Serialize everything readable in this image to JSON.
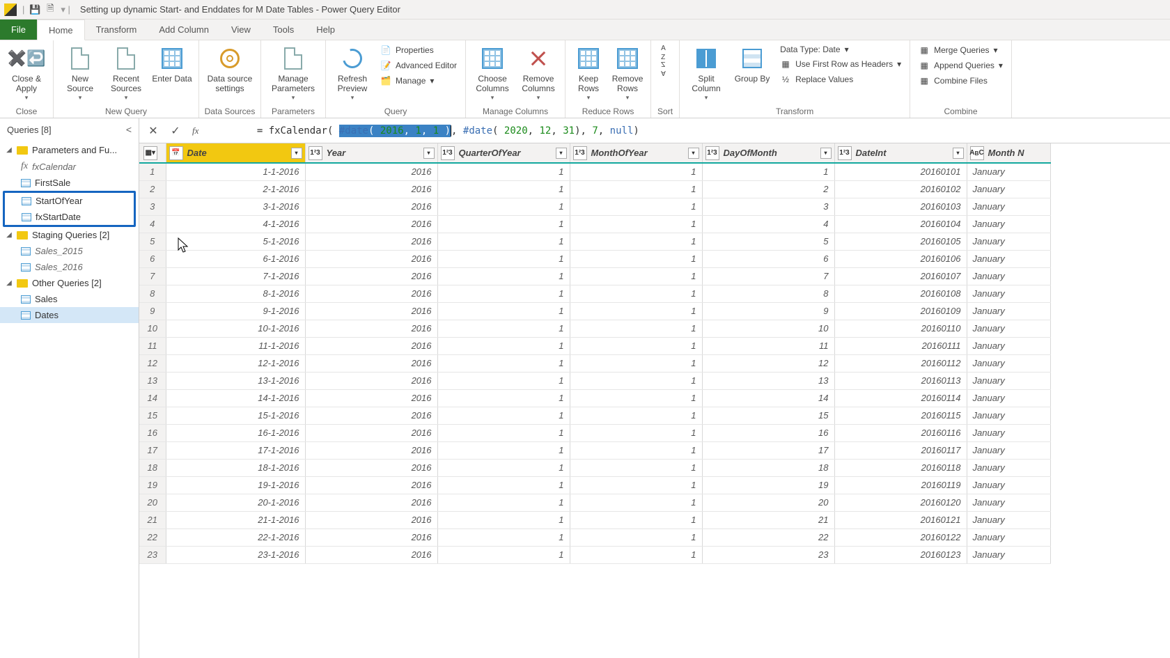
{
  "titlebar": {
    "app_title": "Setting up dynamic Start- and Enddates for M Date Tables - Power Query Editor"
  },
  "ribbon_tabs": {
    "file": "File",
    "home": "Home",
    "transform": "Transform",
    "add_column": "Add Column",
    "view": "View",
    "tools": "Tools",
    "help": "Help"
  },
  "ribbon": {
    "close_apply": "Close & Apply",
    "close_group": "Close",
    "new_source": "New Source",
    "recent_sources": "Recent Sources",
    "enter_data": "Enter Data",
    "new_query_group": "New Query",
    "data_source_settings": "Data source settings",
    "data_sources_group": "Data Sources",
    "manage_parameters": "Manage Parameters",
    "parameters_group": "Parameters",
    "refresh_preview": "Refresh Preview",
    "properties": "Properties",
    "advanced_editor": "Advanced Editor",
    "manage": "Manage",
    "query_group": "Query",
    "choose_columns": "Choose Columns",
    "remove_columns": "Remove Columns",
    "manage_columns_group": "Manage Columns",
    "keep_rows": "Keep Rows",
    "remove_rows": "Remove Rows",
    "reduce_rows_group": "Reduce Rows",
    "sort_group": "Sort",
    "split_column": "Split Column",
    "group_by": "Group By",
    "data_type": "Data Type: Date",
    "first_row_headers": "Use First Row as Headers",
    "replace_values": "Replace Values",
    "transform_group": "Transform",
    "merge_queries": "Merge Queries",
    "append_queries": "Append Queries",
    "combine_files": "Combine Files",
    "combine_group": "Combine"
  },
  "queries_pane": {
    "header": "Queries [8]",
    "group_params": "Parameters and Fu...",
    "fxCalendar": "fxCalendar",
    "FirstSale": "FirstSale",
    "StartOfYear": "StartOfYear",
    "fxStartDate": "fxStartDate",
    "group_staging": "Staging Queries [2]",
    "Sales_2015": "Sales_2015",
    "Sales_2016": "Sales_2016",
    "group_other": "Other Queries [2]",
    "Sales": "Sales",
    "Dates": "Dates"
  },
  "formula_bar": {
    "prefix": "= ",
    "fn": "fxCalendar",
    "open": "( ",
    "sel_part": "#date( 2016, 1, 1 )",
    "mid": ", ",
    "date2_kw": "#date",
    "date2_open": "( ",
    "y2": "2020",
    "c1": ", ",
    "m2": "12",
    "c2": ", ",
    "d2": "31",
    "date2_close": ")",
    "c3": ", ",
    "arg7": "7",
    "c4": ", ",
    "argnull": "null",
    "close": ")"
  },
  "columns": [
    {
      "name": "Date",
      "type": "date",
      "type_icon": "📅"
    },
    {
      "name": "Year",
      "type": "int",
      "type_icon": "1²3"
    },
    {
      "name": "QuarterOfYear",
      "type": "int",
      "type_icon": "1²3"
    },
    {
      "name": "MonthOfYear",
      "type": "int",
      "type_icon": "1²3"
    },
    {
      "name": "DayOfMonth",
      "type": "int",
      "type_icon": "1²3"
    },
    {
      "name": "DateInt",
      "type": "int",
      "type_icon": "1²3"
    },
    {
      "name": "Month N",
      "type": "text",
      "type_icon": "ABC"
    }
  ],
  "rows": [
    {
      "n": "1",
      "Date": "1-1-2016",
      "Year": "2016",
      "QuarterOfYear": "1",
      "MonthOfYear": "1",
      "DayOfMonth": "1",
      "DateInt": "20160101",
      "MonthN": "January"
    },
    {
      "n": "2",
      "Date": "2-1-2016",
      "Year": "2016",
      "QuarterOfYear": "1",
      "MonthOfYear": "1",
      "DayOfMonth": "2",
      "DateInt": "20160102",
      "MonthN": "January"
    },
    {
      "n": "3",
      "Date": "3-1-2016",
      "Year": "2016",
      "QuarterOfYear": "1",
      "MonthOfYear": "1",
      "DayOfMonth": "3",
      "DateInt": "20160103",
      "MonthN": "January"
    },
    {
      "n": "4",
      "Date": "4-1-2016",
      "Year": "2016",
      "QuarterOfYear": "1",
      "MonthOfYear": "1",
      "DayOfMonth": "4",
      "DateInt": "20160104",
      "MonthN": "January"
    },
    {
      "n": "5",
      "Date": "5-1-2016",
      "Year": "2016",
      "QuarterOfYear": "1",
      "MonthOfYear": "1",
      "DayOfMonth": "5",
      "DateInt": "20160105",
      "MonthN": "January"
    },
    {
      "n": "6",
      "Date": "6-1-2016",
      "Year": "2016",
      "QuarterOfYear": "1",
      "MonthOfYear": "1",
      "DayOfMonth": "6",
      "DateInt": "20160106",
      "MonthN": "January"
    },
    {
      "n": "7",
      "Date": "7-1-2016",
      "Year": "2016",
      "QuarterOfYear": "1",
      "MonthOfYear": "1",
      "DayOfMonth": "7",
      "DateInt": "20160107",
      "MonthN": "January"
    },
    {
      "n": "8",
      "Date": "8-1-2016",
      "Year": "2016",
      "QuarterOfYear": "1",
      "MonthOfYear": "1",
      "DayOfMonth": "8",
      "DateInt": "20160108",
      "MonthN": "January"
    },
    {
      "n": "9",
      "Date": "9-1-2016",
      "Year": "2016",
      "QuarterOfYear": "1",
      "MonthOfYear": "1",
      "DayOfMonth": "9",
      "DateInt": "20160109",
      "MonthN": "January"
    },
    {
      "n": "10",
      "Date": "10-1-2016",
      "Year": "2016",
      "QuarterOfYear": "1",
      "MonthOfYear": "1",
      "DayOfMonth": "10",
      "DateInt": "20160110",
      "MonthN": "January"
    },
    {
      "n": "11",
      "Date": "11-1-2016",
      "Year": "2016",
      "QuarterOfYear": "1",
      "MonthOfYear": "1",
      "DayOfMonth": "11",
      "DateInt": "20160111",
      "MonthN": "January"
    },
    {
      "n": "12",
      "Date": "12-1-2016",
      "Year": "2016",
      "QuarterOfYear": "1",
      "MonthOfYear": "1",
      "DayOfMonth": "12",
      "DateInt": "20160112",
      "MonthN": "January"
    },
    {
      "n": "13",
      "Date": "13-1-2016",
      "Year": "2016",
      "QuarterOfYear": "1",
      "MonthOfYear": "1",
      "DayOfMonth": "13",
      "DateInt": "20160113",
      "MonthN": "January"
    },
    {
      "n": "14",
      "Date": "14-1-2016",
      "Year": "2016",
      "QuarterOfYear": "1",
      "MonthOfYear": "1",
      "DayOfMonth": "14",
      "DateInt": "20160114",
      "MonthN": "January"
    },
    {
      "n": "15",
      "Date": "15-1-2016",
      "Year": "2016",
      "QuarterOfYear": "1",
      "MonthOfYear": "1",
      "DayOfMonth": "15",
      "DateInt": "20160115",
      "MonthN": "January"
    },
    {
      "n": "16",
      "Date": "16-1-2016",
      "Year": "2016",
      "QuarterOfYear": "1",
      "MonthOfYear": "1",
      "DayOfMonth": "16",
      "DateInt": "20160116",
      "MonthN": "January"
    },
    {
      "n": "17",
      "Date": "17-1-2016",
      "Year": "2016",
      "QuarterOfYear": "1",
      "MonthOfYear": "1",
      "DayOfMonth": "17",
      "DateInt": "20160117",
      "MonthN": "January"
    },
    {
      "n": "18",
      "Date": "18-1-2016",
      "Year": "2016",
      "QuarterOfYear": "1",
      "MonthOfYear": "1",
      "DayOfMonth": "18",
      "DateInt": "20160118",
      "MonthN": "January"
    },
    {
      "n": "19",
      "Date": "19-1-2016",
      "Year": "2016",
      "QuarterOfYear": "1",
      "MonthOfYear": "1",
      "DayOfMonth": "19",
      "DateInt": "20160119",
      "MonthN": "January"
    },
    {
      "n": "20",
      "Date": "20-1-2016",
      "Year": "2016",
      "QuarterOfYear": "1",
      "MonthOfYear": "1",
      "DayOfMonth": "20",
      "DateInt": "20160120",
      "MonthN": "January"
    },
    {
      "n": "21",
      "Date": "21-1-2016",
      "Year": "2016",
      "QuarterOfYear": "1",
      "MonthOfYear": "1",
      "DayOfMonth": "21",
      "DateInt": "20160121",
      "MonthN": "January"
    },
    {
      "n": "22",
      "Date": "22-1-2016",
      "Year": "2016",
      "QuarterOfYear": "1",
      "MonthOfYear": "1",
      "DayOfMonth": "22",
      "DateInt": "20160122",
      "MonthN": "January"
    },
    {
      "n": "23",
      "Date": "23-1-2016",
      "Year": "2016",
      "QuarterOfYear": "1",
      "MonthOfYear": "1",
      "DayOfMonth": "23",
      "DateInt": "20160123",
      "MonthN": "January"
    }
  ]
}
